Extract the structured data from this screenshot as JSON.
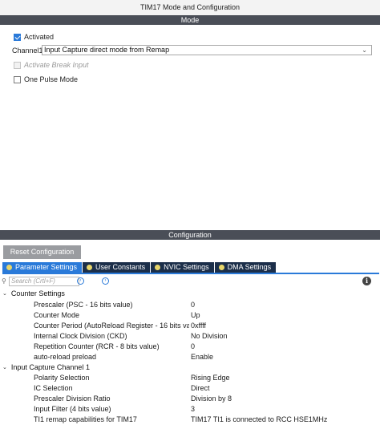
{
  "window": {
    "title": "TIM17 Mode and Configuration"
  },
  "mode": {
    "section_title": "Mode",
    "activated": {
      "label": "Activated",
      "checked": true
    },
    "channel1": {
      "label": "Channel1",
      "value": "Input Capture direct mode from Remap"
    },
    "activate_break_input": {
      "label": "Activate Break Input",
      "checked": false,
      "disabled": true
    },
    "one_pulse_mode": {
      "label": "One Pulse Mode",
      "checked": false
    }
  },
  "configuration": {
    "section_title": "Configuration",
    "reset_label": "Reset Configuration",
    "tabs": [
      {
        "label": "Parameter Settings",
        "active": true
      },
      {
        "label": "User Constants",
        "active": false
      },
      {
        "label": "NVIC Settings",
        "active": false
      },
      {
        "label": "DMA Settings",
        "active": false
      }
    ],
    "search_placeholder": "Search (Crtl+F)",
    "groups": [
      {
        "title": "Counter Settings",
        "params": [
          {
            "name": "Prescaler (PSC - 16 bits value)",
            "value": "0"
          },
          {
            "name": "Counter Mode",
            "value": "Up"
          },
          {
            "name": "Counter Period (AutoReload Register - 16 bits val...",
            "value": "0xffff"
          },
          {
            "name": "Internal Clock Division (CKD)",
            "value": "No Division"
          },
          {
            "name": "Repetition Counter (RCR - 8 bits value)",
            "value": "0"
          },
          {
            "name": "auto-reload preload",
            "value": "Enable"
          }
        ]
      },
      {
        "title": "Input Capture Channel 1",
        "params": [
          {
            "name": "Polarity Selection",
            "value": "Rising Edge"
          },
          {
            "name": "IC Selection",
            "value": "Direct"
          },
          {
            "name": "Prescaler Division Ratio",
            "value": "Division by 8"
          },
          {
            "name": "Input Filter (4 bits value)",
            "value": "3"
          },
          {
            "name": "TI1 remap capabilities for TIM17",
            "value": "TIM17 TI1 is connected to RCC HSE1MHz"
          }
        ]
      }
    ]
  },
  "colors": {
    "section_bar": "#4a4e57",
    "tab_active": "#2a7ad9",
    "tab_inactive": "#1c2f4a",
    "tab_dot": "#e8d66a",
    "reset_button": "#9a9ca0"
  },
  "icons": {
    "search": "magnifier-icon",
    "prev": "chevron-circle-left-icon",
    "next": "chevron-circle-right-icon",
    "info": "info-icon",
    "expand": "chevron-down-icon"
  }
}
